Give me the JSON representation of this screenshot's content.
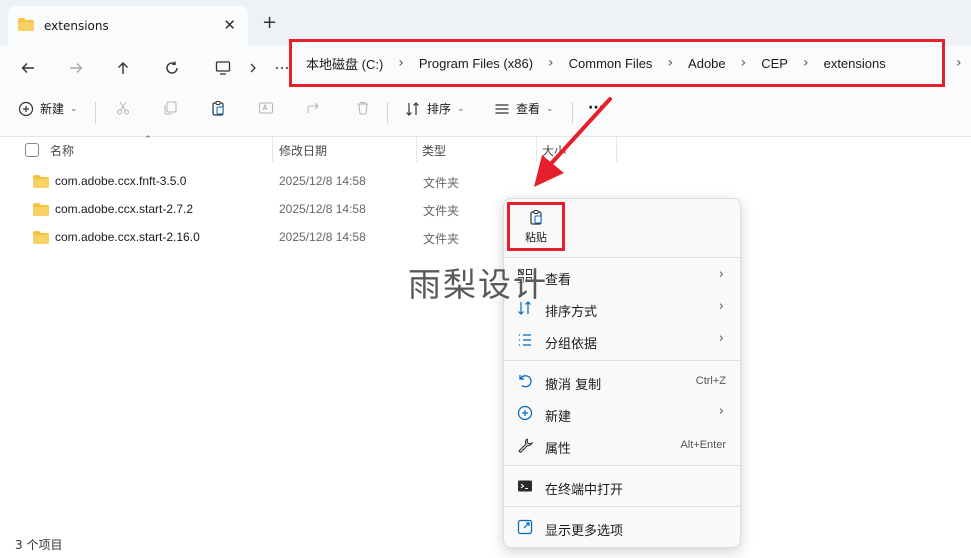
{
  "tab": {
    "title": "extensions",
    "close": "✕",
    "new": "+"
  },
  "address": {
    "crumbs": [
      "本地磁盘 (C:)",
      "Program Files (x86)",
      "Common Files",
      "Adobe",
      "CEP",
      "extensions"
    ],
    "more": "···"
  },
  "commands": {
    "new_label": "新建",
    "sort_label": "排序",
    "view_label": "查看",
    "more": "···"
  },
  "columns": {
    "name": "名称",
    "date": "修改日期",
    "type": "类型",
    "size": "大小"
  },
  "files": [
    {
      "name": "com.adobe.ccx.fnft-3.5.0",
      "date": "2025/12/8 14:58",
      "type": "文件夹"
    },
    {
      "name": "com.adobe.ccx.start-2.7.2",
      "date": "2025/12/8 14:58",
      "type": "文件夹"
    },
    {
      "name": "com.adobe.ccx.start-2.16.0",
      "date": "2025/12/8 14:58",
      "type": "文件夹"
    }
  ],
  "status": {
    "count": "3 个项目"
  },
  "context_menu": {
    "paste": "粘贴",
    "items": [
      {
        "label": "查看",
        "shortcut": "",
        "submenu": true,
        "icon": "grid-icon"
      },
      {
        "label": "排序方式",
        "shortcut": "",
        "submenu": true,
        "icon": "sort-icon"
      },
      {
        "label": "分组依据",
        "shortcut": "",
        "submenu": true,
        "icon": "group-icon"
      },
      {
        "label": "撤消 复制",
        "shortcut": "Ctrl+Z",
        "submenu": false,
        "icon": "undo-icon"
      },
      {
        "label": "新建",
        "shortcut": "",
        "submenu": true,
        "icon": "new-icon"
      },
      {
        "label": "属性",
        "shortcut": "Alt+Enter",
        "submenu": false,
        "icon": "wrench-icon"
      },
      {
        "label": "在终端中打开",
        "shortcut": "",
        "submenu": false,
        "icon": "terminal-icon"
      },
      {
        "label": "显示更多选项",
        "shortcut": "",
        "submenu": false,
        "icon": "more-options-icon"
      }
    ]
  },
  "watermark": "雨梨设计",
  "colors": {
    "highlight": "#e6202a",
    "folder": "#f5c342",
    "accent": "#0067c0"
  }
}
